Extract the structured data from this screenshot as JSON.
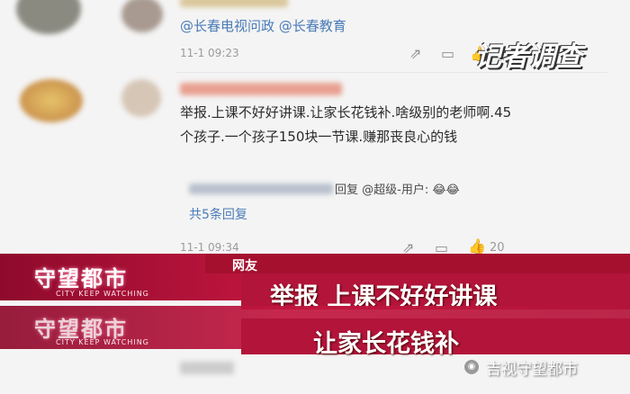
{
  "comment_top": {
    "mentions": "@长春电视问政 @长春教育",
    "time": "11-1 09:23"
  },
  "comment_main": {
    "text": "举报.上课不好好讲课.让家长花钱补.啥级别的老师啊.45个孩子.一个孩子150块一节课.赚那丧良心的钱",
    "reply_preview": "回复 @超级-用户: 😂😂",
    "more_replies": "共5条回复",
    "time": "11-1 09:34",
    "likes": "20"
  },
  "stamp": "记者调查",
  "lower_third": {
    "logo": "守望都市",
    "logo_sub": "CITY KEEP WATCHING",
    "source_tag": "网友",
    "headline_line1": "举报 上课不好好讲课",
    "headline_line2": "让家长花钱补"
  },
  "watermark": "吉视守望都市",
  "colors": {
    "link": "#4a7bb8",
    "band": "#c3163f"
  }
}
